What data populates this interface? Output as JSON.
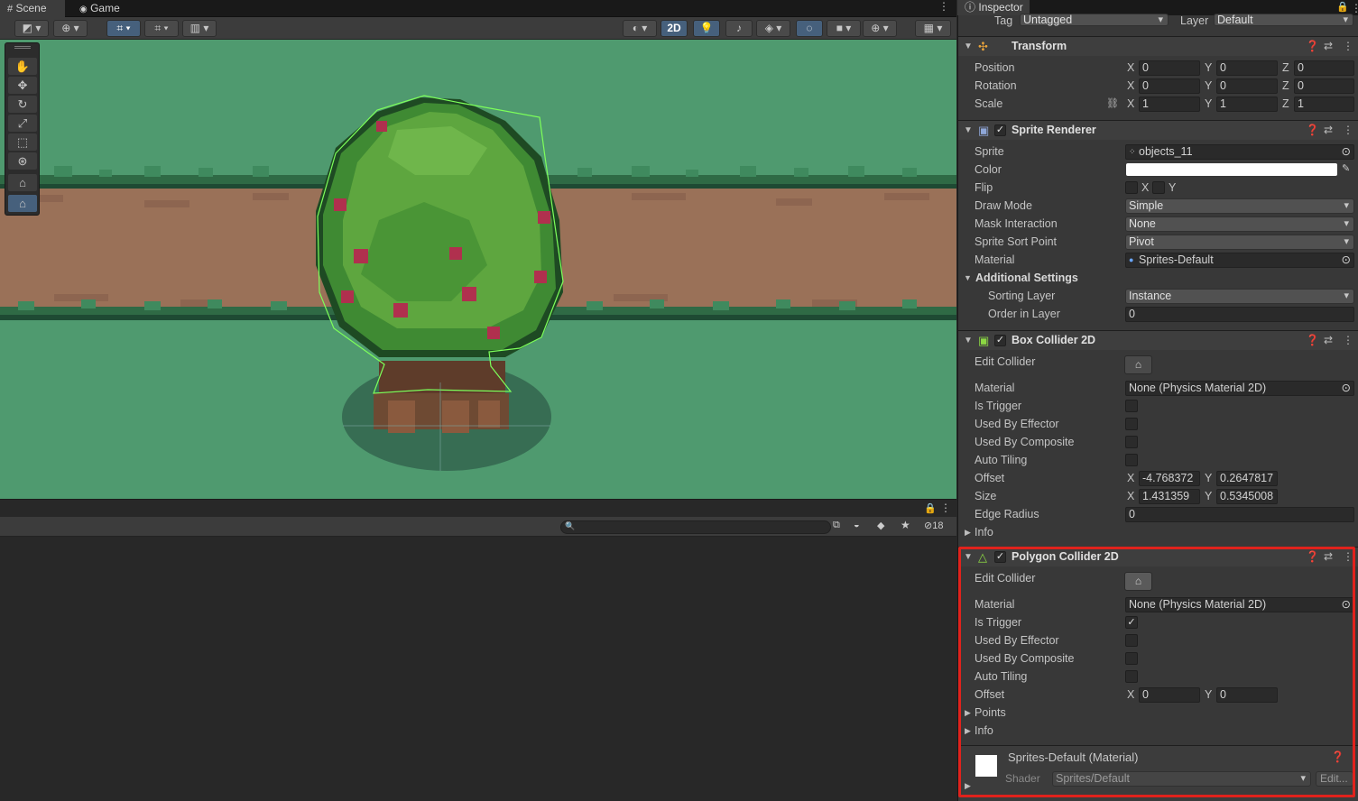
{
  "scene_tabs": [
    {
      "label": "Scene",
      "icon": "grid-icon"
    },
    {
      "label": "Game",
      "icon": "gamepad-icon"
    }
  ],
  "scene_toolbar": {
    "mode_2d": "2D"
  },
  "lower_panel": {
    "hidden_count": "18"
  },
  "inspector": {
    "tab_label": "Inspector",
    "tag_label": "Tag",
    "tag_value": "Untagged",
    "layer_label": "Layer",
    "layer_value": "Default",
    "transform": {
      "title": "Transform",
      "rows": [
        {
          "label": "Position",
          "x": "0",
          "y": "0",
          "z": "0"
        },
        {
          "label": "Rotation",
          "x": "0",
          "y": "0",
          "z": "0"
        },
        {
          "label": "Scale",
          "x": "1",
          "y": "1",
          "z": "1"
        }
      ]
    },
    "sprite_renderer": {
      "title": "Sprite Renderer",
      "sprite_label": "Sprite",
      "sprite_value": "objects_11",
      "color_label": "Color",
      "color_value": "#ffffff",
      "flip_label": "Flip",
      "flip_x": "X",
      "flip_y": "Y",
      "draw_mode_label": "Draw Mode",
      "draw_mode_value": "Simple",
      "mask_label": "Mask Interaction",
      "mask_value": "None",
      "sort_point_label": "Sprite Sort Point",
      "sort_point_value": "Pivot",
      "material_label": "Material",
      "material_value": "Sprites-Default",
      "additional_label": "Additional Settings",
      "sorting_layer_label": "Sorting Layer",
      "sorting_layer_value": "Instance",
      "order_label": "Order in Layer",
      "order_value": "0"
    },
    "box_collider": {
      "title": "Box Collider 2D",
      "edit_label": "Edit Collider",
      "material_label": "Material",
      "material_value": "None (Physics Material 2D)",
      "trigger_label": "Is Trigger",
      "trigger_checked": false,
      "effector_label": "Used By Effector",
      "composite_label": "Used By Composite",
      "tiling_label": "Auto Tiling",
      "offset_label": "Offset",
      "offset_x": "-4.768372",
      "offset_y": "0.2647817",
      "size_label": "Size",
      "size_x": "1.431359",
      "size_y": "0.5345008",
      "edge_label": "Edge Radius",
      "edge_value": "0",
      "info_label": "Info"
    },
    "polygon_collider": {
      "title": "Polygon Collider 2D",
      "edit_label": "Edit Collider",
      "material_label": "Material",
      "material_value": "None (Physics Material 2D)",
      "trigger_label": "Is Trigger",
      "trigger_checked": true,
      "effector_label": "Used By Effector",
      "composite_label": "Used By Composite",
      "tiling_label": "Auto Tiling",
      "offset_label": "Offset",
      "offset_x": "0",
      "offset_y": "0",
      "points_label": "Points",
      "info_label": "Info"
    },
    "material_preview": {
      "title": "Sprites-Default (Material)",
      "shader_label": "Shader",
      "shader_value": "Sprites/Default",
      "edit_button": "Edit..."
    }
  },
  "colors": {
    "highlight": "#e0221c",
    "grass": "#4f9a6f",
    "path": "#9a7158",
    "selected_tool": "#46607c"
  }
}
